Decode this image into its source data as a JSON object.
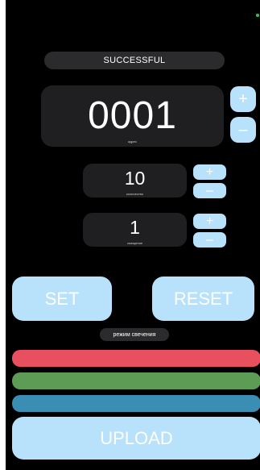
{
  "status": {
    "text": "SUCCESSFUL",
    "indicator_color": "#2ecc40"
  },
  "address": {
    "value": "0001",
    "caption": "адрес",
    "plus": "+",
    "minus": "–"
  },
  "count": {
    "value": "10",
    "caption": "количество",
    "plus": "+",
    "minus": "–"
  },
  "shift": {
    "value": "1",
    "caption": "смещение",
    "plus": "+",
    "minus": "–"
  },
  "actions": {
    "set_label": "SET",
    "reset_label": "RESET",
    "upload_label": "UPLOAD"
  },
  "mode": {
    "label": "режим свечения"
  },
  "color_bars": [
    {
      "name": "red",
      "color": "#e8505f"
    },
    {
      "name": "green",
      "color": "#5c9c55"
    },
    {
      "name": "blue",
      "color": "#3a8db3"
    }
  ],
  "colors": {
    "accent": "#b8e1fb",
    "background": "#000000",
    "card": "#1f1f21"
  }
}
